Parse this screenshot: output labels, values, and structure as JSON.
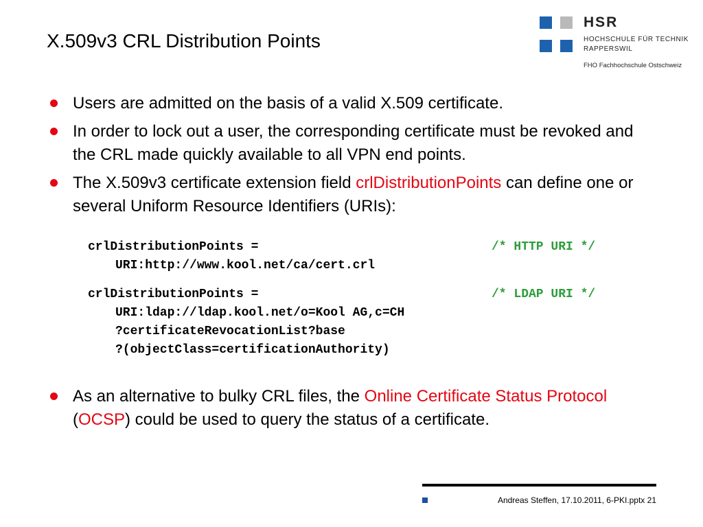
{
  "slide": {
    "title": "X.509v3 CRL Distribution Points"
  },
  "logo": {
    "name": "HSR",
    "line1": "HOCHSCHULE FÜR TECHNIK",
    "line2": "RAPPERSWIL",
    "tagline": "FHO Fachhochschule Ostschweiz",
    "colors": {
      "blue": "#1e62ae",
      "gray": "#b9b9b9"
    }
  },
  "bullets": {
    "b1": "Users are admitted on the basis of a valid X.509 certificate.",
    "b2": "In order to lock out a user, the corresponding certificate must be revoked and the CRL made quickly available to all VPN end points.",
    "b3_pre": "The X.509v3 certificate extension field ",
    "b3_field": "crlDistributionPoints",
    "b3_post": " can define one or several Uniform Resource Identifiers (URIs):",
    "b4_pre": "As an alternative to bulky CRL files, the ",
    "b4_protocol": "Online Certificate Status Protocol",
    "b4_open": " (",
    "b4_acronym": "OCSP",
    "b4_post": ") could be used to query the status of a certificate."
  },
  "code": {
    "http_decl": "crlDistributionPoints =",
    "http_comment": "/* HTTP URI */",
    "http_uri": "URI:http://www.kool.net/ca/cert.crl",
    "ldap_decl": "crlDistributionPoints =",
    "ldap_comment": "/* LDAP URI */",
    "ldap_uri1": "URI:ldap://ldap.kool.net/o=Kool AG,c=CH",
    "ldap_uri2": "?certificateRevocationList?base",
    "ldap_uri3": "?(objectClass=certificationAuthority)"
  },
  "footer": {
    "text": "Andreas Steffen, 17.10.2011, 6-PKI.pptx 21"
  },
  "colors": {
    "accent_red": "#e30613",
    "comment_green": "#2e9d3a",
    "footer_blue": "#1e4fa6"
  }
}
